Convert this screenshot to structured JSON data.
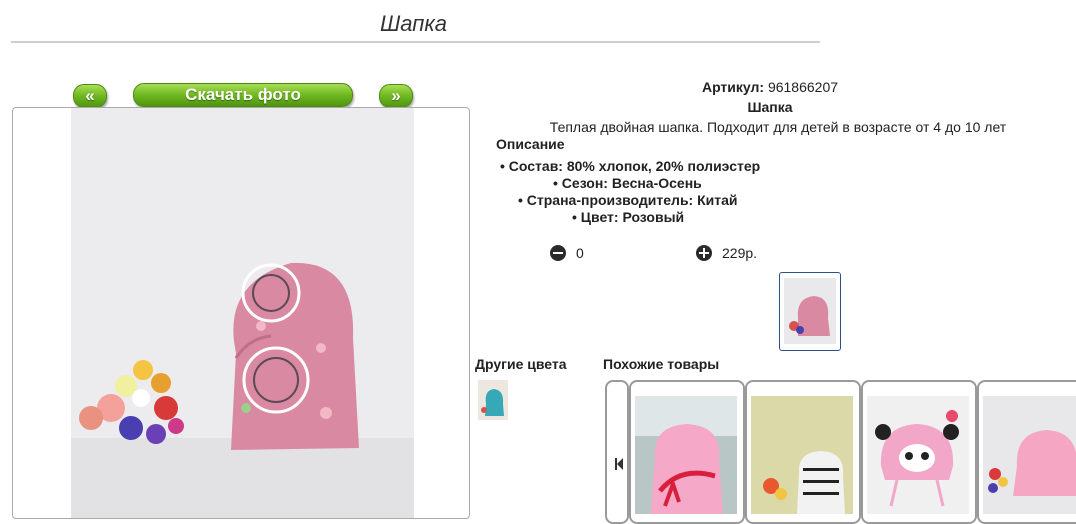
{
  "product": {
    "title": "Шапка",
    "article_label": "Артикул:",
    "article_value": "961866207",
    "name": "Шапка",
    "summary": "Теплая двойная шапка. Подходит для детей в возрасте от 4 до 10 лет",
    "description_title": "Описание",
    "specs": [
      "• Состав: 80% хлопок, 20% полиэстер",
      "• Сезон: Весна-Осень",
      "• Страна-производитель: Китай",
      "• Цвет: Розовый"
    ],
    "quantity": "0",
    "price": "229р."
  },
  "gallery": {
    "prev_label": "«",
    "download_label": "Скачать фото",
    "next_label": "»"
  },
  "other_colors": {
    "title": "Другие цвета"
  },
  "similar": {
    "title": "Похожие товары"
  },
  "colors": {
    "accent_green": "#6fb820",
    "thumb_border": "#2c4f8c",
    "hat_pink": "#d98aa2"
  }
}
